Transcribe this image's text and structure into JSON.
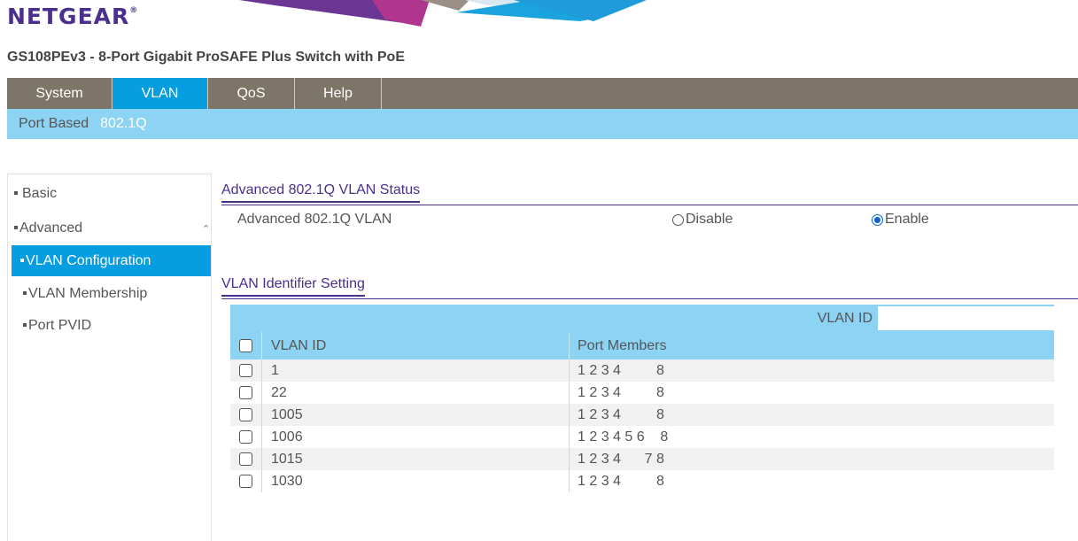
{
  "brand": {
    "logo": "NETGEAR",
    "trademark": "®"
  },
  "product_title": "GS108PEv3 - 8-Port Gigabit ProSAFE Plus Switch with PoE",
  "main_tabs": [
    {
      "label": "System",
      "active": false
    },
    {
      "label": "VLAN",
      "active": true
    },
    {
      "label": "QoS",
      "active": false
    },
    {
      "label": "Help",
      "active": false
    }
  ],
  "sub_tabs": [
    {
      "label": "Port Based",
      "active": false
    },
    {
      "label": "802.1Q",
      "active": true
    }
  ],
  "sidebar": {
    "basic": "Basic",
    "advanced": "Advanced",
    "advanced_icon": "chevron-up-icon",
    "items": [
      {
        "label": "VLAN Configuration",
        "active": true
      },
      {
        "label": "VLAN Membership",
        "active": false
      },
      {
        "label": "Port PVID",
        "active": false
      }
    ]
  },
  "status_section": {
    "title": "Advanced 802.1Q VLAN Status",
    "label": "Advanced 802.1Q VLAN",
    "options": [
      {
        "label": "Disable",
        "checked": false
      },
      {
        "label": "Enable",
        "checked": true
      }
    ]
  },
  "identifier_section": {
    "title": "VLAN Identifier Setting",
    "search_label": "VLAN ID",
    "search_value": "",
    "columns": {
      "id": "VLAN ID",
      "ports": "Port Members"
    },
    "rows": [
      {
        "id": "1",
        "ports": "1 2 3 4         8"
      },
      {
        "id": "22",
        "ports": "1 2 3 4         8"
      },
      {
        "id": "1005",
        "ports": "1 2 3 4         8"
      },
      {
        "id": "1006",
        "ports": "1 2 3 4 5 6    8"
      },
      {
        "id": "1015",
        "ports": "1 2 3 4      7 8"
      },
      {
        "id": "1030",
        "ports": "1 2 3 4         8"
      }
    ]
  },
  "colors": {
    "brand_purple": "#4b2f8c",
    "tab_bar": "#7d7568",
    "active_blue": "#069ee0",
    "light_blue": "#8dd3f3",
    "radio_blue": "#0b62d6"
  }
}
